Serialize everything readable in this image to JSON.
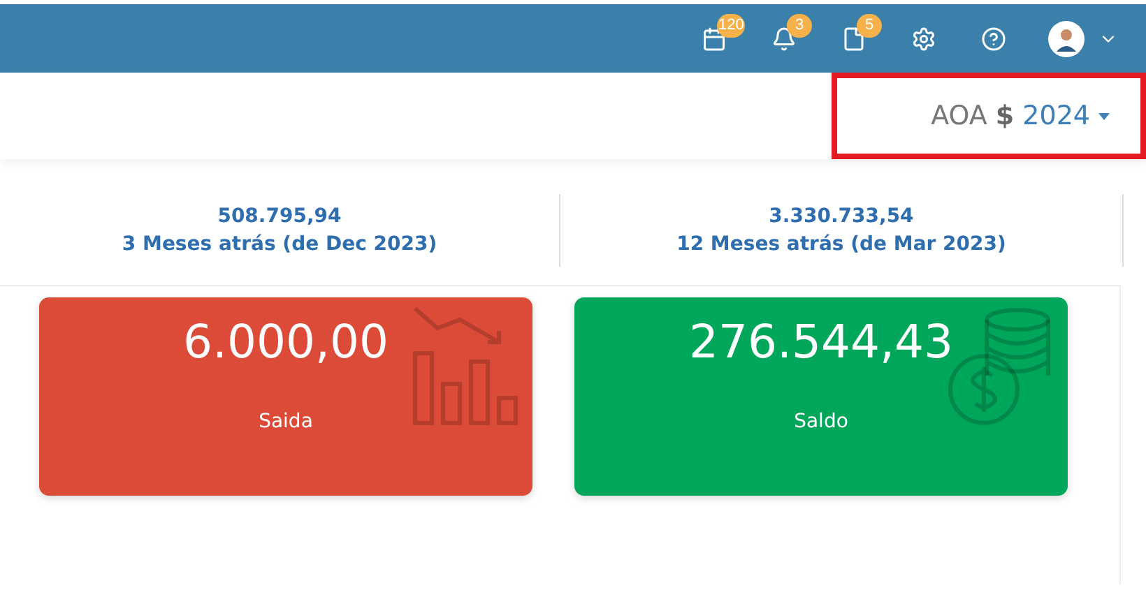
{
  "topbar": {
    "icons": [
      {
        "kind": "calendar",
        "badge": "120"
      },
      {
        "kind": "bell",
        "badge": "3"
      },
      {
        "kind": "document",
        "badge": "5"
      },
      {
        "kind": "settings"
      },
      {
        "kind": "help"
      }
    ]
  },
  "header": {
    "currency": "AOA",
    "symbol": "$",
    "year": "2024",
    "highlighted": true
  },
  "stats": [
    {
      "value": "508.795,94",
      "label": "3 Meses atrás (de Dec 2023)"
    },
    {
      "value": "3.330.733,54",
      "label": "12 Meses atrás (de Mar 2023)"
    }
  ],
  "cards": [
    {
      "kind": "chart",
      "value": "6.000,00",
      "label": "Saida",
      "color": "#dc4b38"
    },
    {
      "kind": "coins",
      "value": "276.544,43",
      "label": "Saldo",
      "color": "#00a65a"
    }
  ]
}
